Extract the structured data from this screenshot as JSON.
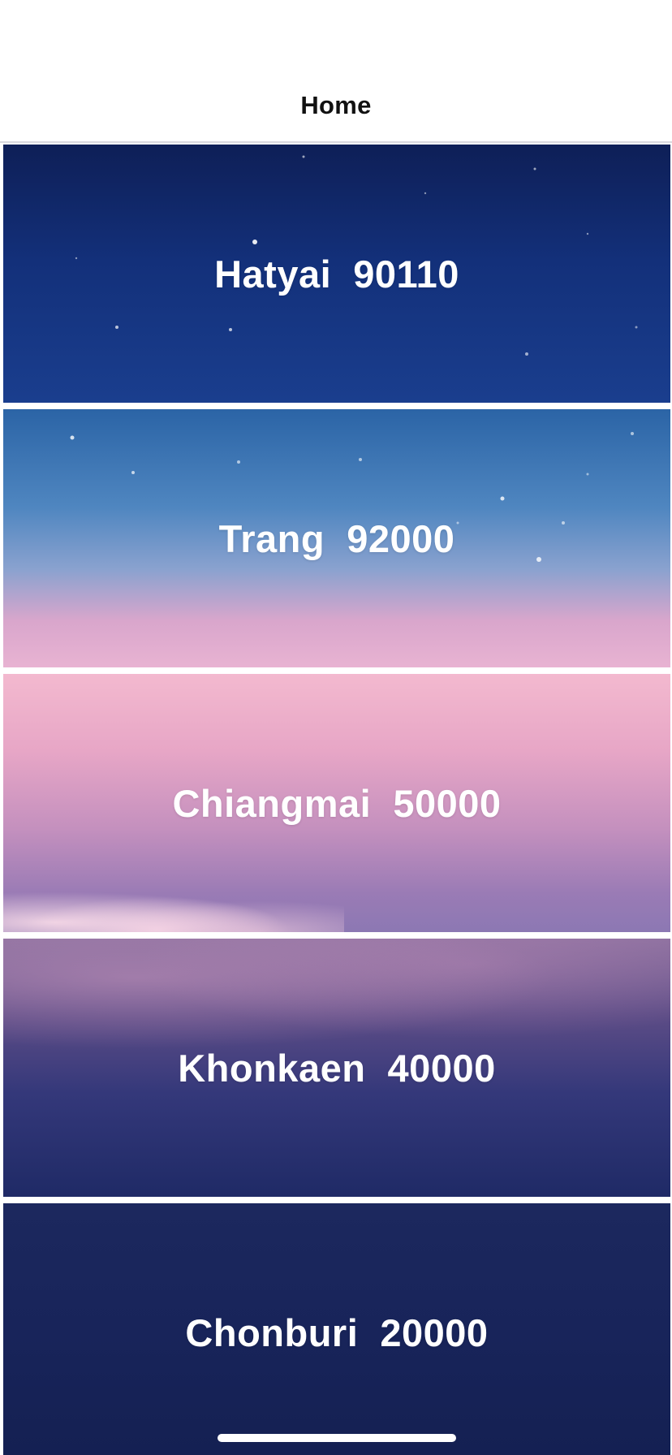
{
  "nav": {
    "title": "Home"
  },
  "cities": [
    {
      "label": "Hatyai  90110"
    },
    {
      "label": "Trang  92000"
    },
    {
      "label": "Chiangmai  50000"
    },
    {
      "label": "Khonkaen  40000"
    },
    {
      "label": "Chonburi  20000"
    }
  ]
}
